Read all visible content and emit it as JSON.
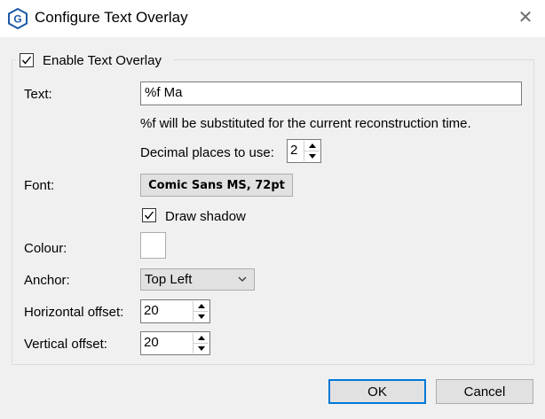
{
  "window": {
    "title": "Configure Text Overlay",
    "app_icon_letter": "G",
    "close_glyph": "✕"
  },
  "enable": {
    "label": "Enable Text Overlay",
    "checked": true
  },
  "text": {
    "label": "Text:",
    "value": "%f Ma",
    "hint": "%f will be substituted for the current reconstruction time."
  },
  "decimal": {
    "label": "Decimal places to use:",
    "value": "2"
  },
  "font": {
    "label": "Font:",
    "button_label": "Comic Sans MS, 72pt"
  },
  "shadow": {
    "label": "Draw shadow",
    "checked": true
  },
  "colour": {
    "label": "Colour:",
    "value_color": "#ffffff"
  },
  "anchor": {
    "label": "Anchor:",
    "selected": "Top Left"
  },
  "horizontal_offset": {
    "label": "Horizontal offset:",
    "value": "20"
  },
  "vertical_offset": {
    "label": "Vertical offset:",
    "value": "20"
  },
  "buttons": {
    "ok": "OK",
    "cancel": "Cancel"
  },
  "colors": {
    "accent": "#0078d7",
    "icon_blue": "#1e5aa8"
  }
}
